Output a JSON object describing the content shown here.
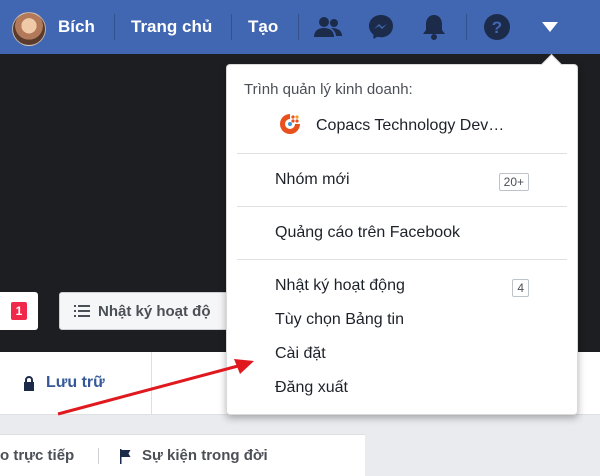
{
  "topbar": {
    "user_name": "Bích",
    "home": "Trang chủ",
    "create": "Tạo",
    "icons": [
      "friends-icon",
      "messenger-icon",
      "notifications-icon",
      "help-icon",
      "dropdown-caret-icon"
    ],
    "color": "#4267b2"
  },
  "cover": {
    "badge": "1",
    "log_button": "Nhật ký hoạt độ"
  },
  "profile_nav": {
    "archive": "Lưu trữ"
  },
  "composer": {
    "live": "o trực tiếp",
    "life_event": "Sự kiện trong đời"
  },
  "menu": {
    "business_heading": "Trình quản lý kinh doanh:",
    "business_page": "Copacs Technology Dev…",
    "new_groups": "Nhóm mới",
    "new_groups_count": "20+",
    "fb_ads": "Quảng cáo trên Facebook",
    "activity_log": "Nhật ký hoạt động",
    "activity_log_count": "4",
    "news_feed_prefs": "Tùy chọn Bảng tin",
    "settings": "Cài đặt",
    "logout": "Đăng xuất"
  },
  "annotation": {
    "arrow_color": "#e0191f"
  }
}
